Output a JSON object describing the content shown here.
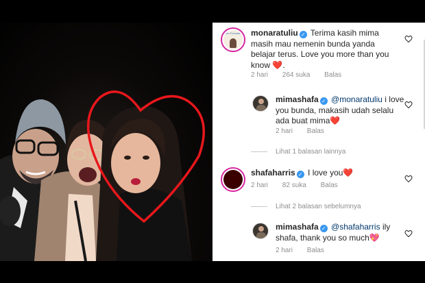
{
  "comments": [
    {
      "username": "monaratuliu",
      "text": "Terima kasih mima masih mau nemenin bunda yanda belajar terus. Love you more than you know",
      "emoji": "❤️",
      "avatar_text": "Pelo Pensalled",
      "time": "2 hari",
      "likes": "264 suka",
      "reply_label": "Balas"
    },
    {
      "username": "mimashafa",
      "mention": "@monaratuliu",
      "text": "i love you bunda, makasih udah selalu ada buat mima",
      "emoji": "❤️",
      "time": "2 hari",
      "reply_label": "Balas"
    },
    {
      "username": "shafaharris",
      "text": "I love you",
      "emoji": "❤️",
      "time": "2 hari",
      "likes": "82 suka",
      "reply_label": "Balas"
    },
    {
      "username": "mimashafa",
      "mention": "@shafaharris",
      "text": "ily shafa, thank you so much",
      "emoji": "💖",
      "time": "2 hari",
      "reply_label": "Balas"
    }
  ],
  "view_replies": [
    "Lihat 1 balasan lainnya",
    "Lihat 2 balasan sebelumnya"
  ],
  "colors": {
    "verified": "#3897f0",
    "mention": "#00376b",
    "heart_drawing": "#e8171c",
    "muted_text": "#8e8e8e"
  }
}
